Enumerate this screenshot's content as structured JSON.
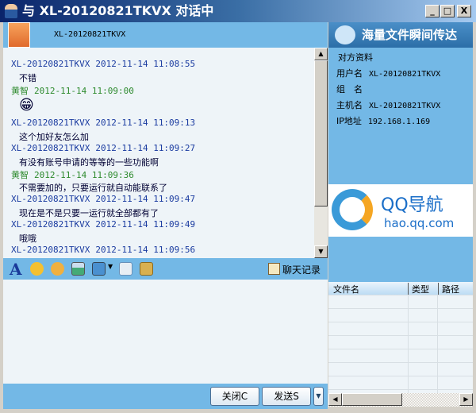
{
  "window": {
    "title": "与 XL-20120821TKVX 对话中",
    "min": "_",
    "max": "□",
    "close": "X"
  },
  "header": {
    "contact": "XL-20120821TKVX"
  },
  "messages": [
    {
      "sender": "XL-20120821TKVX",
      "time": "2012-11-14 11:08:55",
      "text": "不错",
      "self": false
    },
    {
      "sender": "黄智",
      "time": "2012-11-14 11:09:00",
      "text": "😁",
      "self": true
    },
    {
      "sender": "XL-20120821TKVX",
      "time": "2012-11-14 11:09:13",
      "text": "这个加好友怎么加",
      "self": false
    },
    {
      "sender": "XL-20120821TKVX",
      "time": "2012-11-14 11:09:27",
      "text": "有没有账号申请的等等的一些功能啊",
      "self": false
    },
    {
      "sender": "黄智",
      "time": "2012-11-14 11:09:36",
      "text": "不需要加的，只要运行就自动能联系了",
      "self": true
    },
    {
      "sender": "XL-20120821TKVX",
      "time": "2012-11-14 11:09:47",
      "text": "现在是不是只要一运行就全部都有了",
      "self": false
    },
    {
      "sender": "XL-20120821TKVX",
      "time": "2012-11-14 11:09:49",
      "text": "哦哦",
      "self": false
    },
    {
      "sender": "XL-20120821TKVX",
      "time": "2012-11-14 11:09:56",
      "text": "",
      "self": false
    }
  ],
  "toolbar": {
    "history": "聊天记录"
  },
  "buttons": {
    "close": "关闭C",
    "send": "发送S"
  },
  "right": {
    "banner": "海量文件瞬间传达",
    "info_title": "对方资料",
    "fields": [
      {
        "label": "用户名",
        "value": "XL-20120821TKVX"
      },
      {
        "label": "组　名",
        "value": ""
      },
      {
        "label": "主机名",
        "value": "XL-20120821TKVX"
      },
      {
        "label": "IP地址",
        "value": "192.168.1.169"
      }
    ],
    "ad": {
      "title": "QQ导航",
      "url": "hao.qq.com"
    },
    "file_columns": [
      "文件名",
      "类型",
      "路径"
    ]
  }
}
